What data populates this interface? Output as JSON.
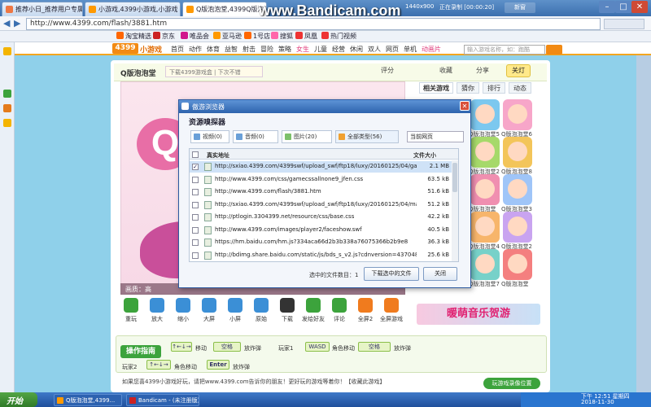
{
  "watermark": "www.Bandicam.com",
  "tabs": [
    {
      "label": "推荐小日_推荐用户专属的",
      "color": "#e74"
    },
    {
      "label": "小游戏,4399小游戏,小游戏",
      "color": "#f90"
    },
    {
      "label": "Q版泡泡堂,4399Q版泡泡堂",
      "color": "#f90"
    }
  ],
  "recorder": {
    "resolution": "1440x900",
    "status": "正在录制 [00:00:20]",
    "new_tab": "新窗"
  },
  "address": {
    "url": "http://www.4399.com/flash/3881.htm"
  },
  "bookmarks": [
    "淘宝精选",
    "京东",
    "唯品会",
    "亚马逊",
    "1号店",
    "搜狐",
    "凤凰",
    "热门视频"
  ],
  "site": {
    "logo": "4399",
    "logo_text": "小游戏",
    "nav": [
      "首页",
      "动作",
      "体育",
      "益智",
      "射击",
      "冒险",
      "策略",
      "女生",
      "儿童",
      "经营",
      "休闲",
      "双人",
      "网页",
      "单机",
      "动画片"
    ],
    "search_placeholder": "输入游戏名称，如：跑酷"
  },
  "game": {
    "title": "Q版泡泡堂",
    "download_hint": "下载4399游戏盒 | 下次不错",
    "buttons": {
      "fav_count": "评分",
      "collect": "收藏",
      "share": "分享",
      "light": "关灯"
    },
    "logo_letter": "Q",
    "quality": "画质：高"
  },
  "right_tabs": [
    "相关游戏",
    "猜你",
    "排行",
    "动态"
  ],
  "right_games": [
    {
      "label": "Q版泡泡堂5",
      "bg": "#7cc8ef"
    },
    {
      "label": "Q版泡泡堂6",
      "bg": "#f7a6c9"
    },
    {
      "label": "Q版泡泡堂2",
      "bg": "#a6d96a"
    },
    {
      "label": "Q版泡泡堂8",
      "bg": "#f3c55a"
    },
    {
      "label": "Q版泡泡堂",
      "bg": "#f08fb0"
    },
    {
      "label": "Q版泡泡堂3",
      "bg": "#9fc5f8"
    },
    {
      "label": "Q版泡泡堂4",
      "bg": "#f7b56b"
    },
    {
      "label": "Q版泡泡堂2",
      "bg": "#c9a4f0"
    },
    {
      "label": "Q版泡泡堂7",
      "bg": "#77d1c9"
    },
    {
      "label": "Q版泡泡堂",
      "bg": "#f47f7f"
    }
  ],
  "toolbar": [
    {
      "label": "重玩",
      "icon": "replay-icon",
      "color": "#3ca33c"
    },
    {
      "label": "放大",
      "icon": "zoom-in-icon",
      "color": "#3b8fd6"
    },
    {
      "label": "缩小",
      "icon": "zoom-out-icon",
      "color": "#3b8fd6"
    },
    {
      "label": "大屏",
      "icon": "fullscreen-icon",
      "color": "#3b8fd6"
    },
    {
      "label": "小屏",
      "icon": "small-screen-icon",
      "color": "#3b8fd6"
    },
    {
      "label": "原始",
      "icon": "original-size-icon",
      "color": "#3b8fd6"
    },
    {
      "label": "下载",
      "icon": "mobile-download-icon",
      "color": "#333"
    },
    {
      "label": "发给好友",
      "icon": "send-friend-icon",
      "color": "#3ca33c"
    },
    {
      "label": "评论",
      "icon": "comment-icon",
      "color": "#3ca33c"
    },
    {
      "label": "全屏2",
      "icon": "fullscreen2-icon",
      "color": "#f07b1e"
    },
    {
      "label": "全屏游戏",
      "icon": "fullscreen-game-icon",
      "color": "#f07b1e"
    }
  ],
  "banner": "暖萌音乐贺游",
  "guide": {
    "button": "操作指南",
    "p1_move": "移动",
    "p1_key": "空格",
    "p1_bomb": "放炸弹",
    "p1_name": "玩家1",
    "role_move": "角色移动",
    "p2_key": "空格",
    "p2_bomb": "放炸弹",
    "p2_name": "玩家2",
    "p2_move": "角色移动",
    "enter_key": "Enter",
    "enter_bomb": "放炸弹"
  },
  "share_text": "如果您喜4399小游戏好玩，请把www.4399.com告诉你的朋友！更好玩的游戏等着你！【收藏此游戏】",
  "record_btn": "玩游戏录像位置",
  "dialog": {
    "title": "傲游浏览器",
    "header": "资源嗅探器",
    "filters": [
      {
        "label": "视频(0)",
        "color": "#6aa0d8"
      },
      {
        "label": "音频(0)",
        "color": "#6aa0d8"
      },
      {
        "label": "图片(20)",
        "color": "#7cc06a"
      },
      {
        "label": "全部类型(56)",
        "color": "#f0a030"
      }
    ],
    "page_select": "当前网页",
    "col_url": "真实地址",
    "col_size": "文件大小",
    "rows": [
      {
        "checked": true,
        "url": "http://sxiao.4399.com/4399swf/upload_swf/ftp18/luxy/20160125/04/ga...",
        "size": "2.1 MB"
      },
      {
        "checked": false,
        "url": "http://www.4399.com/css/gamecssallnone9_jfen.css",
        "size": "63.5 kB"
      },
      {
        "checked": false,
        "url": "http://www.4399.com/flash/3881.htm",
        "size": "51.6 kB"
      },
      {
        "checked": false,
        "url": "http://sxiao.4399.com/4399swf/upload_swf/ftp18/luxy/20160125/04/mainl...",
        "size": "51.2 kB"
      },
      {
        "checked": false,
        "url": "http://ptlogin.3304399.net/resource/css/base.css",
        "size": "42.2 kB"
      },
      {
        "checked": false,
        "url": "http://www.4399.com/images/player2/faceshow.swf",
        "size": "40.5 kB"
      },
      {
        "checked": false,
        "url": "https://hm.baidu.com/hm.js?334aca66d2b3b338a76075366b2b9e8",
        "size": "36.3 kB"
      },
      {
        "checked": false,
        "url": "http://bdimg.share.baidu.com/static/js/bds_s_v2.js?cdnversion=437048",
        "size": "25.6 kB"
      }
    ],
    "selected_info": "选中的文件数目：1",
    "download_btn": "下载选中的文件",
    "close_btn": "关闭"
  },
  "taskbar": {
    "start": "开始",
    "items": [
      {
        "label": "Q版泡泡堂,4399...",
        "color": "#f90"
      },
      {
        "label": "Bandicam - (未注册版)",
        "color": "#c22"
      }
    ],
    "time": "下午 12:51",
    "date": "2018-11-30",
    "weekday": "星期四"
  }
}
